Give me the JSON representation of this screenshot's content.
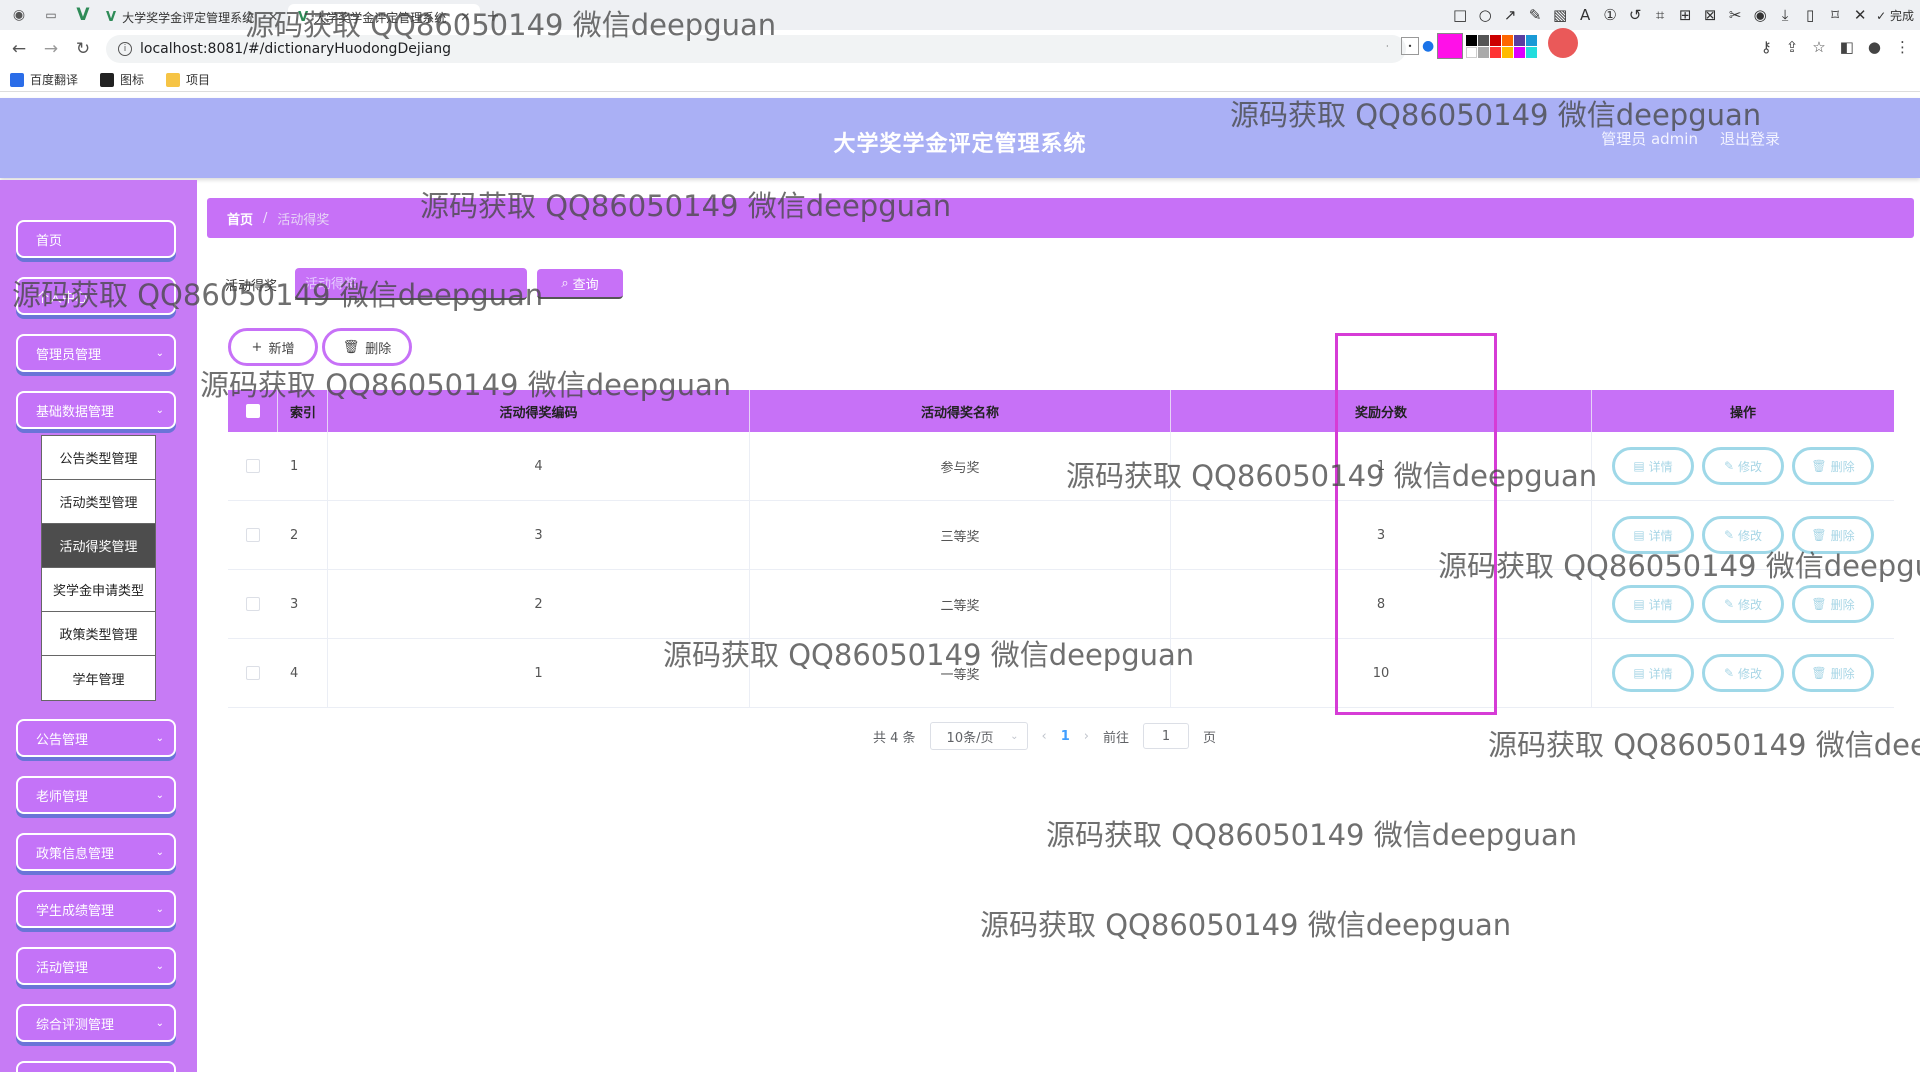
{
  "browser": {
    "tabs": [
      {
        "title": "大学奖学金评定管理系统",
        "active": false
      },
      {
        "title": "大学奖学金评定管理系统",
        "active": true
      }
    ],
    "url": "localhost:8081/#/dictionaryHuodongDejiang",
    "bookmarks": [
      "百度翻译",
      "图标",
      "项目"
    ],
    "screenshot_tool_done": "完成"
  },
  "header": {
    "title": "大学奖学金评定管理系统",
    "user": "管理员 admin",
    "logout": "退出登录"
  },
  "sidebar": {
    "items": [
      {
        "label": "首页"
      },
      {
        "label": "个人中心"
      },
      {
        "label": "管理员管理"
      },
      {
        "label": "基础数据管理"
      },
      {
        "label": "公告管理"
      },
      {
        "label": "老师管理"
      },
      {
        "label": "政策信息管理"
      },
      {
        "label": "学生成绩管理"
      },
      {
        "label": "活动管理"
      },
      {
        "label": "综合评测管理"
      }
    ],
    "submenu": [
      "公告类型管理",
      "活动类型管理",
      "活动得奖管理",
      "奖学金申请类型",
      "政策类型管理",
      "学年管理"
    ]
  },
  "breadcrumb": {
    "home": "首页",
    "separator": "/",
    "current": "活动得奖"
  },
  "search": {
    "label": "活动得奖",
    "placeholder": "活动得奖",
    "button": "查询"
  },
  "actions": {
    "add": "新增",
    "delete": "删除"
  },
  "table": {
    "columns": [
      "索引",
      "活动得奖编码",
      "活动得奖名称",
      "奖励分数",
      "操作"
    ],
    "rows": [
      {
        "index": "1",
        "code": "4",
        "name": "参与奖",
        "score": "1"
      },
      {
        "index": "2",
        "code": "3",
        "name": "三等奖",
        "score": "3"
      },
      {
        "index": "3",
        "code": "2",
        "name": "二等奖",
        "score": "8"
      },
      {
        "index": "4",
        "code": "1",
        "name": "一等奖",
        "score": "10"
      }
    ],
    "row_actions": {
      "detail": "详情",
      "edit": "修改",
      "delete": "删除"
    }
  },
  "pagination": {
    "total": "共 4 条",
    "page_size": "10条/页",
    "current_page": "1",
    "goto_label": "前往",
    "goto_value": "1",
    "page_unit": "页"
  },
  "watermark": "源码获取 QQ86050149 微信deepguan",
  "colors": {
    "header": "#aab0f5",
    "sidebar": "#c77bf5",
    "accent": "#c771f7",
    "highlight_box": "#d63cd6"
  }
}
